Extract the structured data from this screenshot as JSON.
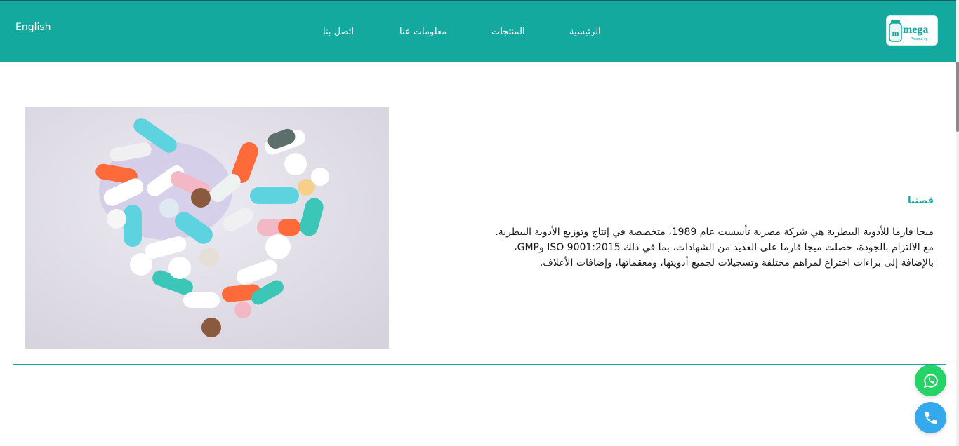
{
  "header": {
    "language_link": "English",
    "nav": [
      {
        "label": "الرئيسية"
      },
      {
        "label": "المنتجات"
      },
      {
        "label": "معلومات عنا"
      },
      {
        "label": "اتصل بنا"
      }
    ],
    "logo_text": "mega",
    "logo_subtext": "Pharma eg"
  },
  "main": {
    "image_alt": "pills-heart-image",
    "story_title": "قصتنا",
    "story_text": "ميجا فارما للأدوية البيطرية هي شركة مصرية تأسست عام 1989، متخصصة في إنتاج وتوزيع الأدوية البيطرية. مع الالتزام بالجودة، حصلت ميجا فارما على العديد من الشهادات، بما في ذلك ISO 9001:2015 وGMP، بالإضافة إلى براءات اختراع لمراهم مختلفة وتسجيلات لجميع أدويتها، ومعقماتها، وإضافات الأعلاف."
  },
  "floating": {
    "whatsapp_icon": "whatsapp-icon",
    "phone_icon": "phone-icon"
  },
  "colors": {
    "brand": "#14a99e",
    "whatsapp": "#25d366",
    "phone": "#36a9ec"
  }
}
